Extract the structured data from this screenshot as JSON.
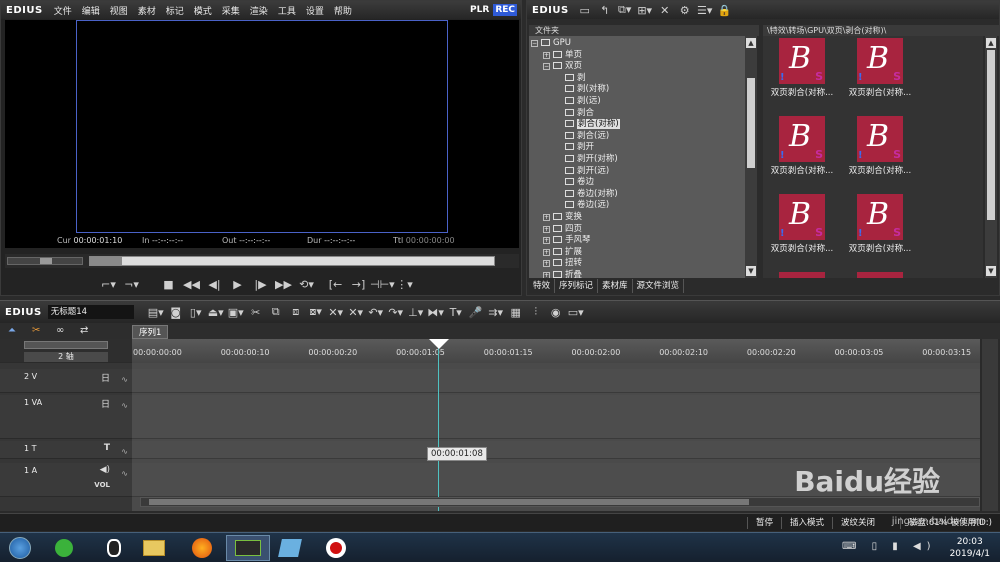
{
  "app": {
    "logo": "EDIUS"
  },
  "player": {
    "menu": [
      "文件",
      "编辑",
      "视图",
      "素材",
      "标记",
      "模式",
      "采集",
      "渲染",
      "工具",
      "设置",
      "帮助"
    ],
    "plr": "PLR",
    "rec": "REC",
    "timecodes": {
      "cur_label": "Cur",
      "cur": "00:00:01:10",
      "in_label": "In",
      "in": "--:--:--:--",
      "out_label": "Out",
      "out": "--:--:--:--",
      "dur_label": "Dur",
      "dur": "--:--:--:--",
      "ttl_label": "Ttl",
      "ttl": "00:00:00:00"
    },
    "progress": 0.08
  },
  "bin": {
    "logo": "EDIUS",
    "folder_header": "文件夹",
    "path": "\\特效\\转场\\GPU\\双页\\剥合(对称)\\",
    "tree": [
      {
        "label": "GPU",
        "level": 0,
        "expander": "−"
      },
      {
        "label": "单页",
        "level": 1,
        "expander": "+"
      },
      {
        "label": "双页",
        "level": 1,
        "expander": "−"
      },
      {
        "label": "剥",
        "level": 2,
        "expander": ""
      },
      {
        "label": "剥(对称)",
        "level": 2,
        "expander": ""
      },
      {
        "label": "剥(远)",
        "level": 2,
        "expander": ""
      },
      {
        "label": "剥合",
        "level": 2,
        "expander": ""
      },
      {
        "label": "剥合(对称)",
        "level": 2,
        "expander": "",
        "selected": true
      },
      {
        "label": "剥合(远)",
        "level": 2,
        "expander": ""
      },
      {
        "label": "剥开",
        "level": 2,
        "expander": ""
      },
      {
        "label": "剥开(对称)",
        "level": 2,
        "expander": ""
      },
      {
        "label": "剥开(远)",
        "level": 2,
        "expander": ""
      },
      {
        "label": "卷边",
        "level": 2,
        "expander": ""
      },
      {
        "label": "卷边(对称)",
        "level": 2,
        "expander": ""
      },
      {
        "label": "卷边(远)",
        "level": 2,
        "expander": ""
      },
      {
        "label": "变换",
        "level": 1,
        "expander": "+"
      },
      {
        "label": "四页",
        "level": 1,
        "expander": "+"
      },
      {
        "label": "手风琴",
        "level": 1,
        "expander": "+"
      },
      {
        "label": "扩展",
        "level": 1,
        "expander": "+"
      },
      {
        "label": "扭转",
        "level": 1,
        "expander": "+"
      },
      {
        "label": "折叠",
        "level": 1,
        "expander": "+"
      }
    ],
    "thumbnails": [
      "双页剥合(对称...",
      "双页剥合(对称...",
      "双页剥合(对称...",
      "双页剥合(对称...",
      "双页剥合(对称...",
      "双页剥合(对称..."
    ],
    "thumb_letter": "B",
    "thumb_s": "S",
    "thumb_ex": "!",
    "tabs": [
      "特效",
      "序列标记",
      "素材库",
      "源文件浏览"
    ]
  },
  "timeline": {
    "logo": "EDIUS",
    "project": "无标题14",
    "sequence_tab": "序列1",
    "ruler": [
      "00:00:00:00",
      "00:00:00:10",
      "00:00:00:20",
      "00:00:01:05",
      "00:00:01:15",
      "00:00:02:00",
      "00:00:02:10",
      "00:00:02:20",
      "00:00:03:05",
      "00:00:03:15"
    ],
    "channel_label": "2 轴",
    "tracks": [
      {
        "name": "2 V",
        "icon": "日"
      },
      {
        "name": "1 VA",
        "icon": "日"
      },
      {
        "name": "1 T",
        "icon": "T"
      },
      {
        "name": "1 A",
        "icon": "◀)",
        "extra": "VOL"
      }
    ],
    "tooltip": "00:00:01:08",
    "status": [
      "暂停",
      "插入模式",
      "波纹关闭",
      "",
      "磁盘:61% 被使用(D:)"
    ]
  },
  "taskbar": {
    "time": "20:03",
    "date": "2019/4/1"
  },
  "watermark": {
    "brand": "Baidu经验",
    "url": "jingyan.baidu.com"
  },
  "colors": {
    "rec": "#2f5bd8",
    "cursor": "#4fc2c2",
    "thumb_bg": "#a8243f"
  }
}
